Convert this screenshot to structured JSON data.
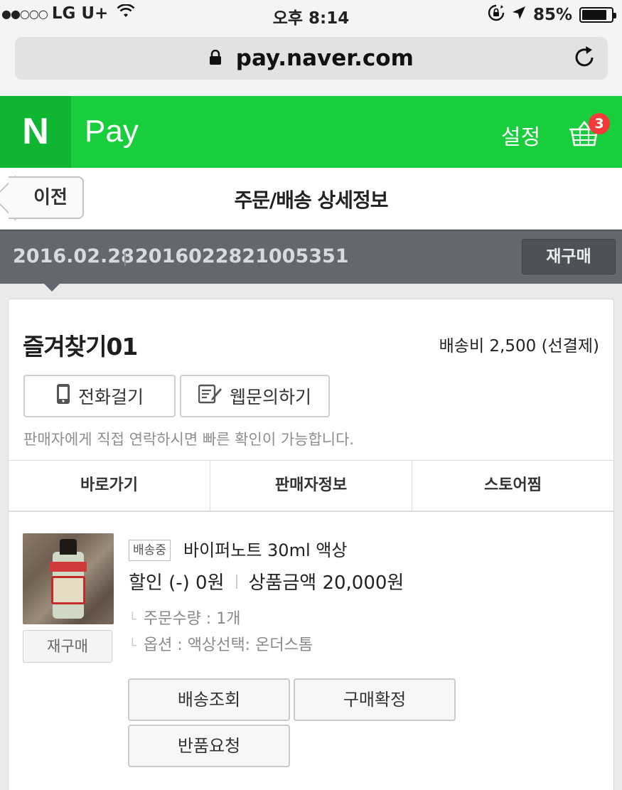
{
  "status_bar": {
    "signal_dots": "●●○○○",
    "carrier": "LG U+",
    "time": "오후 8:14",
    "battery_percent": "85%",
    "battery_level": 0.85
  },
  "browser": {
    "url": "pay.naver.com"
  },
  "header": {
    "logo_letter": "N",
    "brand": "Pay",
    "settings_label": "설정",
    "cart_count": "3",
    "accent_color": "#19ce3c"
  },
  "title_bar": {
    "back_label": "이전",
    "title": "주문/배송 상세정보"
  },
  "order": {
    "date": "2016.02.28",
    "number": "2016022821005351",
    "rebuy_label": "재구매"
  },
  "store": {
    "name": "즐겨찾기01",
    "shipping_fee": "배송비 2,500 (선결제)",
    "call_label": "전화걸기",
    "web_inquiry_label": "웹문의하기",
    "contact_note": "판매자에게 직접 연락하시면 빠른 확인이 가능합니다.",
    "links": [
      "바로가기",
      "판매자정보",
      "스토어찜"
    ]
  },
  "product": {
    "status_tag": "배송중",
    "name": "바이퍼노트 30ml 액상",
    "discount": "할인 (-) 0원",
    "price": "상품금액 20,000원",
    "quantity": "주문수량 : 1개",
    "option": "옵션 : 액상선택: 온더스톰",
    "rebuy_label": "재구매",
    "actions": {
      "track": "배송조회",
      "confirm": "구매확정",
      "return": "반품요청"
    }
  }
}
